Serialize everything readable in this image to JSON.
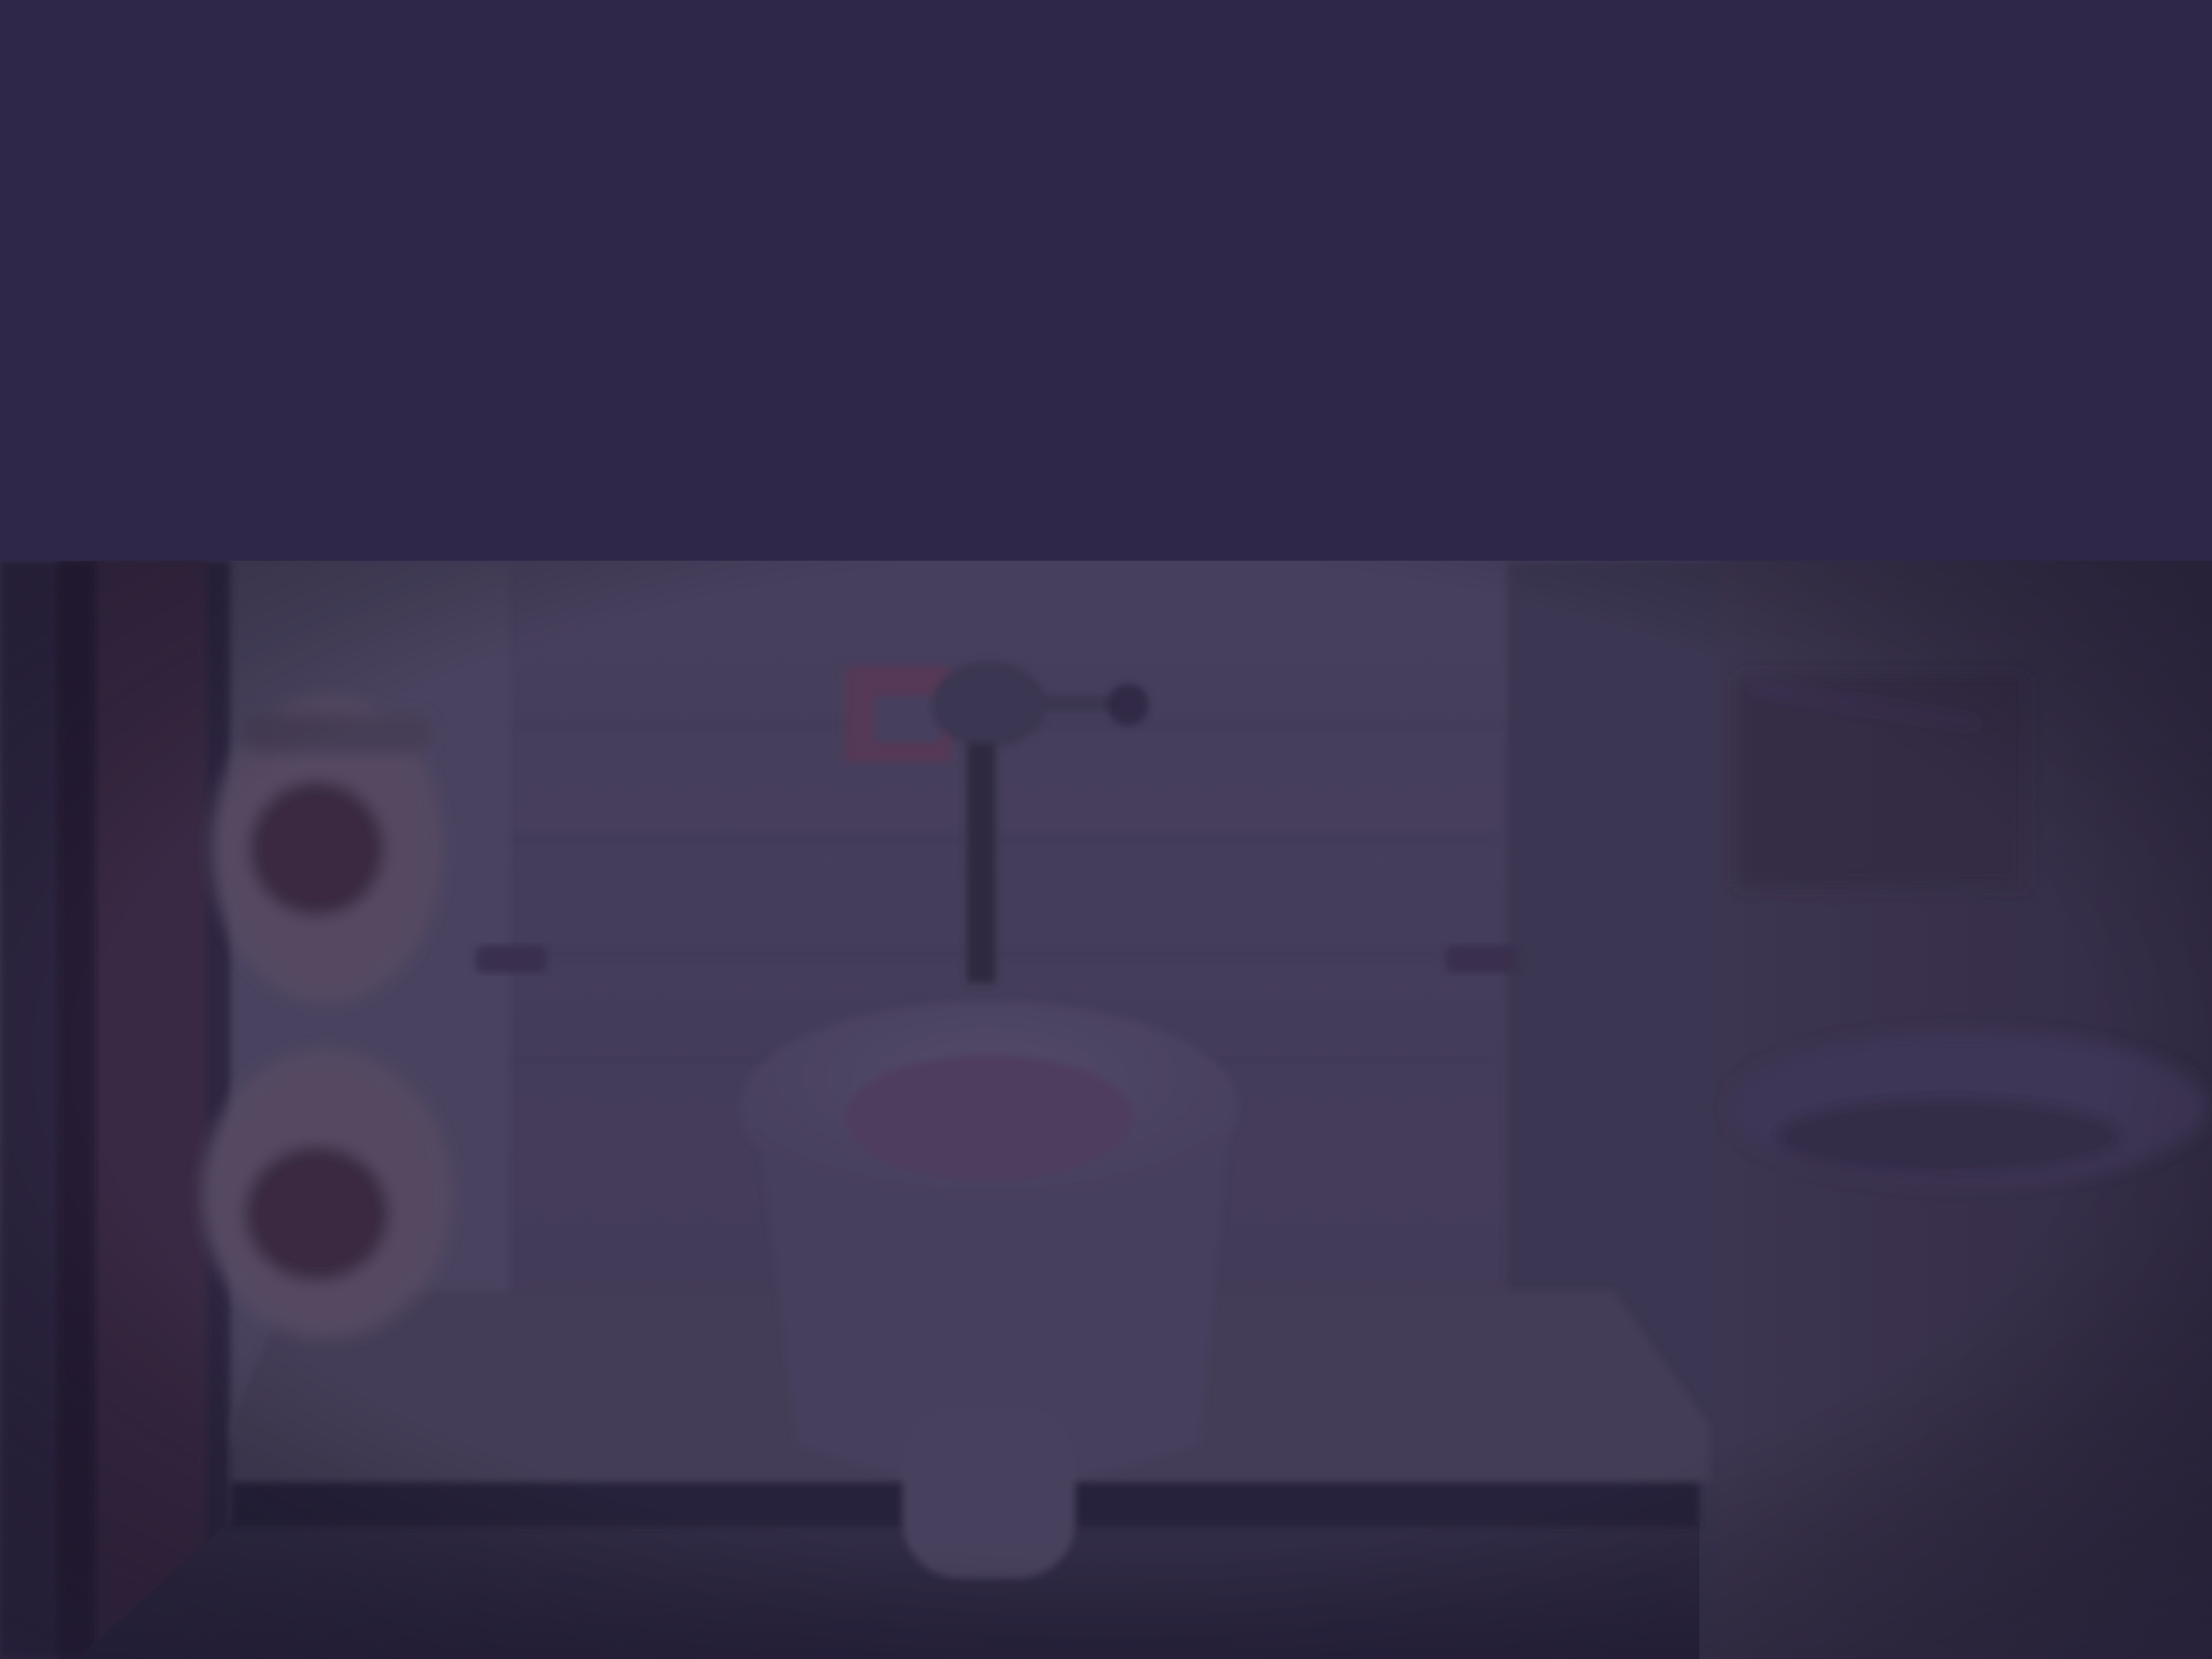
{
  "scene": {
    "subject": "toilet-stall-photo",
    "overlay_color": "#2e2749",
    "overlay_opacity": 0.6,
    "palette": {
      "band": "#2e2749",
      "wall": "#4a4260",
      "wall_shade": "#3e3750",
      "floor": "#2c2840",
      "porcelain": "#5a5270",
      "bowl_inner": "#524060",
      "door_frame": "#2a2238",
      "accent_red": "#6a3a55"
    }
  }
}
